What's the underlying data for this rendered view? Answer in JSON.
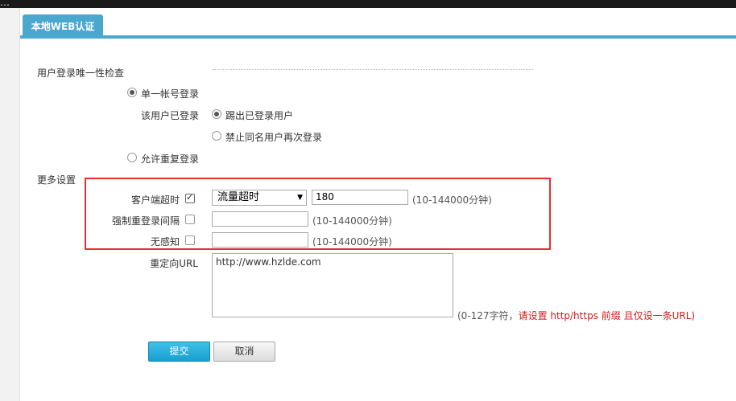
{
  "topbar": {
    "glyph": "…"
  },
  "tab": {
    "label": "本地WEB认证"
  },
  "login_check": {
    "title": "用户登录唯一性检查",
    "single_account": "单一帐号登录",
    "already_logged_label": "该用户已登录",
    "kick_user": "踢出已登录用户",
    "forbid_relogin": "禁止同名用户再次登录",
    "allow_repeat": "允许重复登录"
  },
  "more_settings": {
    "title": "更多设置",
    "client_timeout_label": "客户端超时",
    "timeout_type_selected": "流量超时",
    "timeout_value": "180",
    "timeout_range": "(10-144000分钟)",
    "force_relogin_label": "强制重登录间隔",
    "force_relogin_value": "",
    "force_relogin_range": "(10-144000分钟)",
    "seamless_label": "无感知",
    "seamless_value": "",
    "seamless_range": "(10-144000分钟)",
    "redirect_label": "重定向URL",
    "redirect_value": "http://www.hzlde.com",
    "redirect_hint_prefix": "(0-127字符，",
    "redirect_hint_warn": "请设置 http/https 前缀 且仅设一条URL)"
  },
  "buttons": {
    "submit": "提交",
    "cancel": "取消"
  },
  "colors": {
    "accent": "#4aa8cf",
    "highlight_box": "#e53030",
    "warning": "#d21c1c"
  }
}
